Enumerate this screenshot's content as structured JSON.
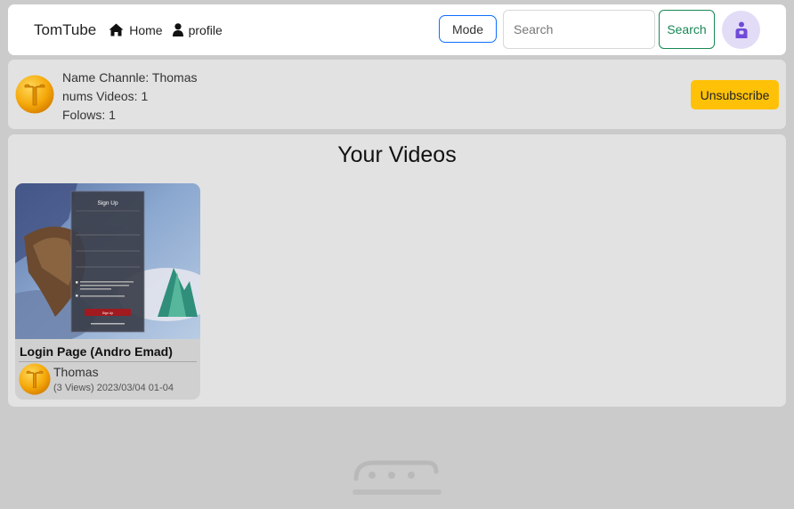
{
  "navbar": {
    "brand": "TomTube",
    "home_label": "Home",
    "profile_label": "profile",
    "mode_label": "Mode",
    "search_placeholder": "Search",
    "search_button": "Search"
  },
  "channel": {
    "logo_letter": "T",
    "name_line": "Name Channle: Thomas",
    "videos_line": "nums Videos: 1",
    "follows_line": "Folows: 1",
    "unsubscribe_label": "Unsubscribe"
  },
  "videos_section": {
    "heading": "Your Videos",
    "items": [
      {
        "title": "Login Page (Andro Emad)",
        "channel": "Thomas",
        "meta": "(3 Views) 2023/03/04 01-04",
        "logo_letter": "T",
        "thumb_heading": "Sign Up",
        "thumb_button": "Sign Up"
      }
    ]
  },
  "colors": {
    "accent_blue": "#0d6efd",
    "accent_green": "#198754",
    "warning_yellow": "#ffc107",
    "logo_orange": "#f4a800"
  },
  "icons": {
    "home": "home-icon",
    "profile": "user-icon",
    "avatar": "user-avatar-icon"
  }
}
